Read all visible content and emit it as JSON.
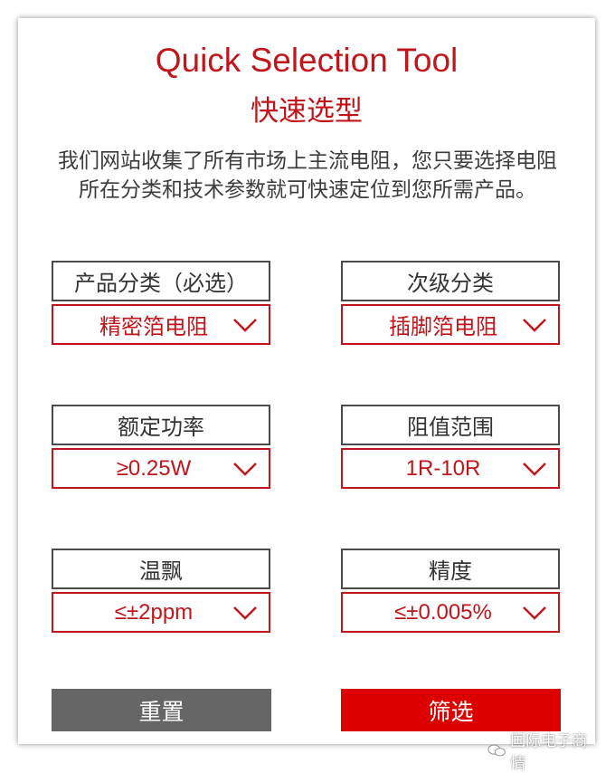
{
  "header": {
    "title_en": "Quick Selection Tool",
    "title_zh": "快速选型",
    "description": "我们网站收集了所有市场上主流电阻，您只要选择电阻所在分类和技术参数就可快速定位到您所需产品。"
  },
  "fields": {
    "category": {
      "label": "产品分类（必选）",
      "value": "精密箔电阻"
    },
    "subcategory": {
      "label": "次级分类",
      "value": "插脚箔电阻"
    },
    "power": {
      "label": "额定功率",
      "value": "≥0.25W"
    },
    "resistance": {
      "label": "阻值范围",
      "value": "1R-10R"
    },
    "tempco": {
      "label": "温飘",
      "value": "≤±2ppm"
    },
    "tolerance": {
      "label": "精度",
      "value": "≤±0.005%"
    }
  },
  "buttons": {
    "reset": "重置",
    "filter": "筛选"
  },
  "watermark": {
    "text": "国际电子商情",
    "icon": "wechat-icon"
  },
  "colors": {
    "accent": "#c0151b",
    "filter_button": "#dd0000",
    "reset_button": "#666666"
  }
}
